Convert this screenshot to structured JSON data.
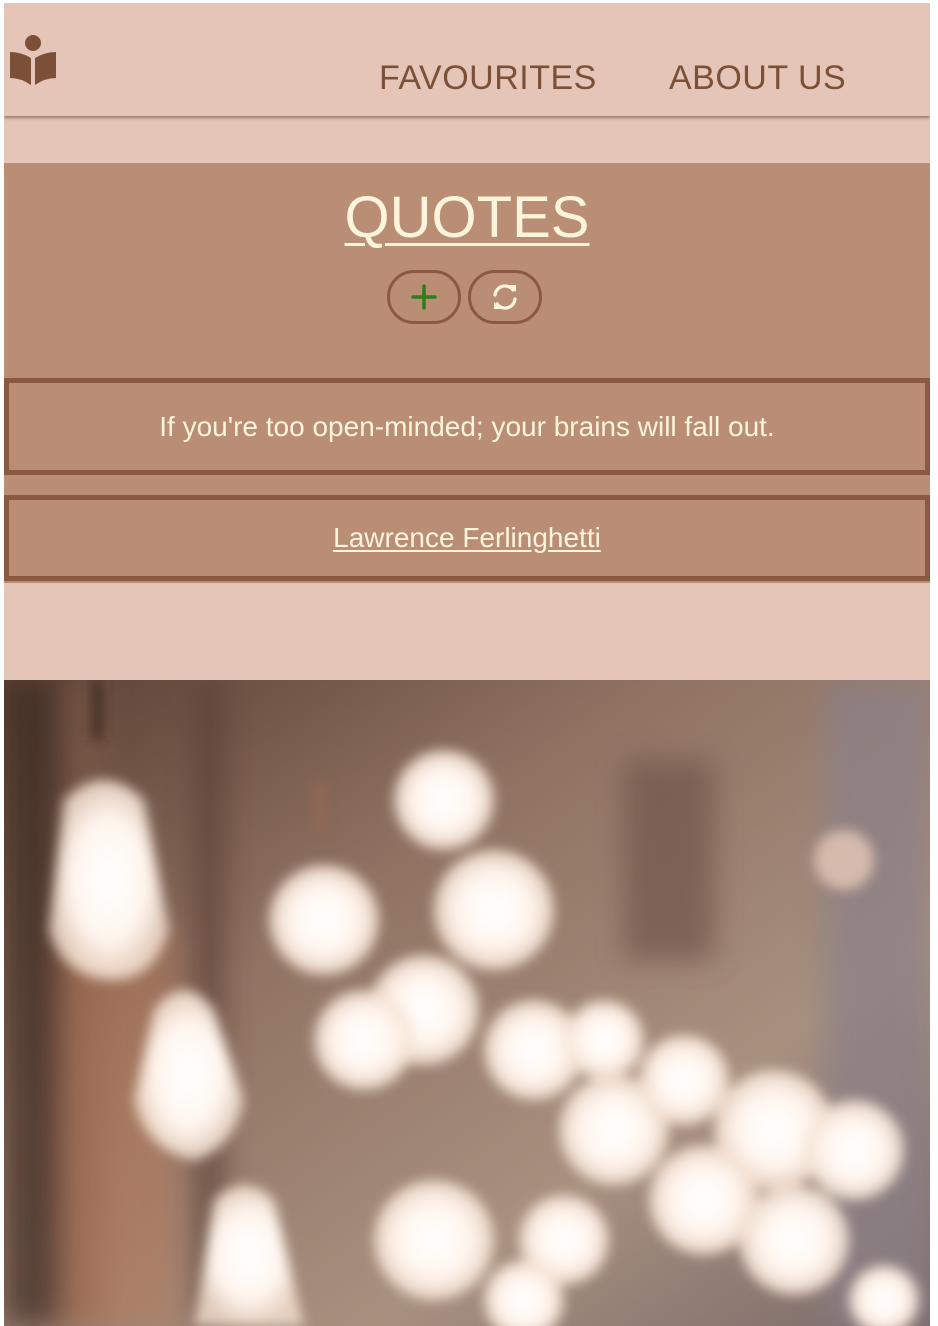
{
  "nav": {
    "logo_icon": "reading-book-icon",
    "links": [
      "FAVOURITES",
      "ABOUT US"
    ]
  },
  "quote_section": {
    "title": "QUOTES",
    "add_icon": "plus-icon",
    "refresh_icon": "refresh-icon",
    "quote_text": "If you're too open-minded; your brains will fall out.",
    "author": "Lawrence Ferlinghetti"
  },
  "photo": {
    "subject": "blurred-light-bulbs-image"
  },
  "colors": {
    "page_background": "#e4c5b8",
    "section_background": "#b98e74",
    "border": "#8a5a40",
    "nav_text": "#7b5036",
    "light_text": "#fdf4dc",
    "add_icon_color": "#2e7d1e"
  }
}
